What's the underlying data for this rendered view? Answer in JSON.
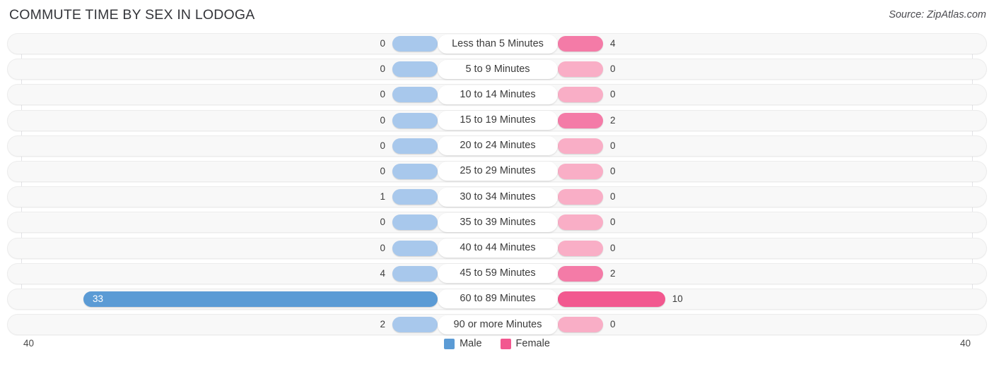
{
  "header": {
    "title": "COMMUTE TIME BY SEX IN LODOGA",
    "source": "Source: ZipAtlas.com"
  },
  "axis": {
    "left_max_label": "40",
    "right_max_label": "40"
  },
  "legend": {
    "items": [
      {
        "label": "Male",
        "color": "#5b9bd5"
      },
      {
        "label": "Female",
        "color": "#f2588f"
      }
    ]
  },
  "chart_data": {
    "type": "bar",
    "title": "COMMUTE TIME BY SEX IN LODOGA",
    "subtitle": "Source: ZipAtlas.com",
    "orientation": "horizontal-diverging",
    "xlabel": "",
    "ylabel": "",
    "xlim": [
      40,
      40
    ],
    "grid": true,
    "legend_position": "bottom-center",
    "categories": [
      "Less than 5 Minutes",
      "5 to 9 Minutes",
      "10 to 14 Minutes",
      "15 to 19 Minutes",
      "20 to 24 Minutes",
      "25 to 29 Minutes",
      "30 to 34 Minutes",
      "35 to 39 Minutes",
      "40 to 44 Minutes",
      "45 to 59 Minutes",
      "60 to 89 Minutes",
      "90 or more Minutes"
    ],
    "series": [
      {
        "name": "Male",
        "color": "#5b9bd5",
        "side": "left",
        "values": [
          0,
          0,
          0,
          0,
          0,
          0,
          1,
          0,
          0,
          4,
          33,
          2
        ]
      },
      {
        "name": "Female",
        "color": "#f2588f",
        "side": "right",
        "values": [
          4,
          0,
          0,
          2,
          0,
          0,
          0,
          0,
          0,
          2,
          10,
          0
        ]
      }
    ],
    "rows": [
      {
        "category": "Less than 5 Minutes",
        "male": 0,
        "female": 4,
        "male_label": "0",
        "female_label": "4",
        "male_tone": "light",
        "female_tone": "mid"
      },
      {
        "category": "5 to 9 Minutes",
        "male": 0,
        "female": 0,
        "male_label": "0",
        "female_label": "0",
        "male_tone": "light",
        "female_tone": "light"
      },
      {
        "category": "10 to 14 Minutes",
        "male": 0,
        "female": 0,
        "male_label": "0",
        "female_label": "0",
        "male_tone": "light",
        "female_tone": "light"
      },
      {
        "category": "15 to 19 Minutes",
        "male": 0,
        "female": 2,
        "male_label": "0",
        "female_label": "2",
        "male_tone": "light",
        "female_tone": "mid"
      },
      {
        "category": "20 to 24 Minutes",
        "male": 0,
        "female": 0,
        "male_label": "0",
        "female_label": "0",
        "male_tone": "light",
        "female_tone": "light"
      },
      {
        "category": "25 to 29 Minutes",
        "male": 0,
        "female": 0,
        "male_label": "0",
        "female_label": "0",
        "male_tone": "light",
        "female_tone": "light"
      },
      {
        "category": "30 to 34 Minutes",
        "male": 1,
        "female": 0,
        "male_label": "1",
        "female_label": "0",
        "male_tone": "light",
        "female_tone": "light"
      },
      {
        "category": "35 to 39 Minutes",
        "male": 0,
        "female": 0,
        "male_label": "0",
        "female_label": "0",
        "male_tone": "light",
        "female_tone": "light"
      },
      {
        "category": "40 to 44 Minutes",
        "male": 0,
        "female": 0,
        "male_label": "0",
        "female_label": "0",
        "male_tone": "light",
        "female_tone": "light"
      },
      {
        "category": "45 to 59 Minutes",
        "male": 4,
        "female": 2,
        "male_label": "4",
        "female_label": "2",
        "male_tone": "light",
        "female_tone": "mid"
      },
      {
        "category": "60 to 89 Minutes",
        "male": 33,
        "female": 10,
        "male_label": "33",
        "female_label": "10",
        "male_tone": "hot",
        "female_tone": "hot"
      },
      {
        "category": "90 or more Minutes",
        "male": 2,
        "female": 0,
        "male_label": "2",
        "female_label": "0",
        "male_tone": "light",
        "female_tone": "light"
      }
    ]
  }
}
